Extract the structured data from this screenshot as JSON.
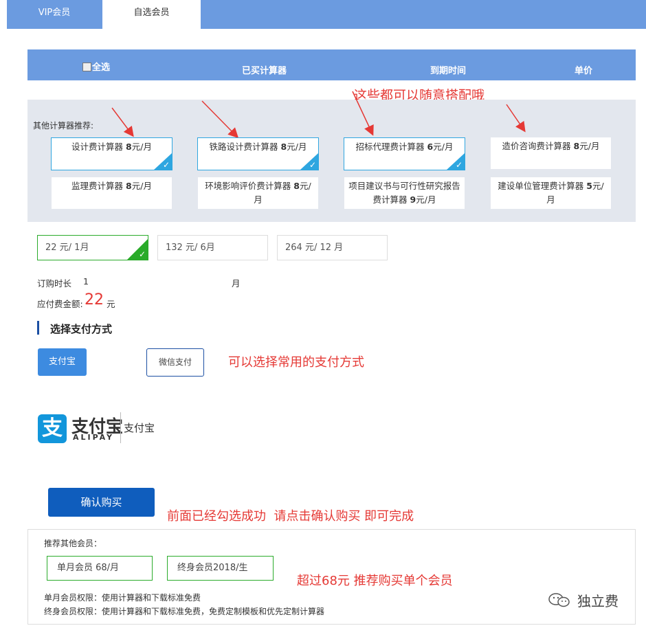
{
  "tabs": {
    "vip": "VIP会员",
    "self_select": "自选会员"
  },
  "table_header": {
    "select_all": "全选",
    "bought": "已买计算器",
    "expire": "到期时间",
    "price": "单价"
  },
  "annotations": {
    "mix_match": "这些都可以随意搭配哦",
    "pay_method": "可以选择常用的支付方式",
    "confirm_hint": "前面已经勾选成功  请点击确认购买 即可完成",
    "over_68": "超过68元 推荐购买单个会员"
  },
  "recommend": {
    "title": "其他计算器推荐:",
    "row1": [
      {
        "name": "设计费计算器 ",
        "price": "8",
        "unit": "元/月",
        "selected": true
      },
      {
        "name": "铁路设计费计算器 ",
        "price": "8",
        "unit": "元/月",
        "selected": true
      },
      {
        "name": "招标代理费计算器 ",
        "price": "6",
        "unit": "元/月",
        "selected": true
      },
      {
        "name": "造价咨询费计算器 ",
        "price": "8",
        "unit": "元/月",
        "selected": false
      }
    ],
    "row2": [
      {
        "line1": "监理费计算器 ",
        "price": "8",
        "line1b": "元/月",
        "line2": ""
      },
      {
        "line1": "环境影响评价费计算器 ",
        "price": "8",
        "line1b": "元/",
        "line2": "月"
      },
      {
        "line1": "项目建议书与可行性研究报告",
        "line2a": "费计算器 ",
        "price": "9",
        "line2b": "元/月"
      },
      {
        "line1": "建设单位管理费计算器 ",
        "price": "5",
        "line1b": "元/",
        "line2": "月"
      }
    ]
  },
  "durations": [
    {
      "label": "22 元/ 1月",
      "selected": true
    },
    {
      "label": "132 元/ 6月",
      "selected": false
    },
    {
      "label": "264 元/ 12 月",
      "selected": false
    }
  ],
  "order": {
    "duration_label": "订购时长",
    "duration_value": "1",
    "duration_unit": "月",
    "amount_label": "应付费金额:",
    "amount_value": "22",
    "amount_unit": "元"
  },
  "payment": {
    "section_title": "选择支付方式",
    "alipay": "支付宝",
    "wechat": "微信支付",
    "logo_cn": "支付宝",
    "logo_en": "ALIPAY",
    "logo_text": "支付宝",
    "logo_icon": "支"
  },
  "confirm_label": "确认购买",
  "members": {
    "title": "推荐其他会员：",
    "monthly": "单月会员 68/月",
    "lifetime": "终身会员2018/生",
    "monthly_rights": "单月会员权限：使用计算器和下载标准免费",
    "lifetime_rights": "终身会员权限：使用计算器和下载标准免费，免费定制模板和优先定制计算器"
  },
  "brand": "独立费",
  "colors": {
    "header_blue": "#6b9be0",
    "select_blue": "#2ea6e0",
    "green": "#2aab2a",
    "red_note": "#e53935",
    "confirm_blue": "#0f5dbd"
  }
}
